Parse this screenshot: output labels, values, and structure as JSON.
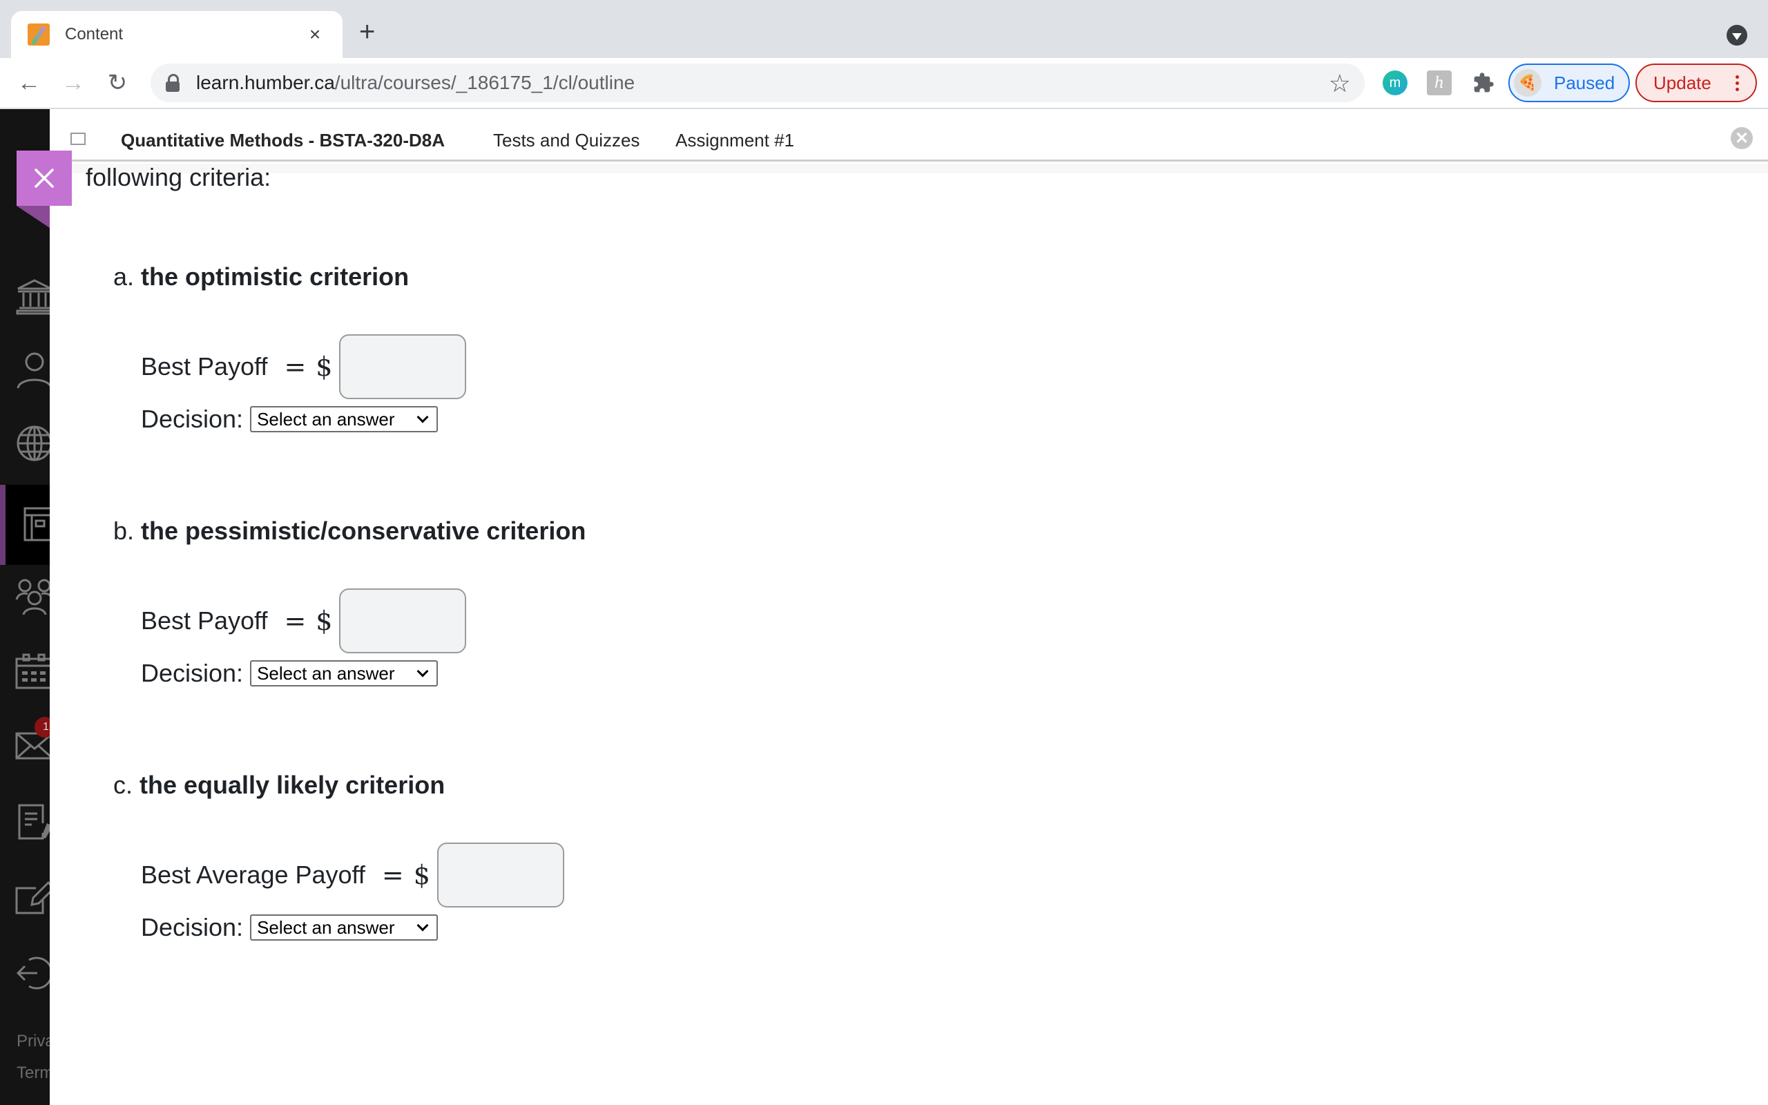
{
  "browser": {
    "tab": {
      "title": "Content",
      "favicon": "pencil-icon",
      "close_glyph": "×"
    },
    "new_tab_glyph": "+",
    "address": {
      "domain": "learn.humber.ca",
      "path": "/ultra/courses/_186175_1/cl/outline"
    },
    "nav": {
      "back_glyph": "←",
      "forward_glyph": "→",
      "reload_glyph": "↻"
    },
    "star_glyph": "☆",
    "extensions": [
      {
        "name": "m-extension",
        "label": "m"
      },
      {
        "name": "h-extension",
        "label": "h"
      },
      {
        "name": "extensions-puzzle",
        "label": "✱"
      }
    ],
    "profile": {
      "label": "Paused",
      "avatar_glyph": "🍕"
    },
    "update": {
      "label": "Update"
    },
    "colors": {
      "profile": "#1a73e8",
      "update": "#c5221f"
    }
  },
  "leftnav": {
    "items": [
      {
        "name": "institution",
        "icon": "institution-icon"
      },
      {
        "name": "profile",
        "icon": "person-icon"
      },
      {
        "name": "activity",
        "icon": "globe-icon"
      },
      {
        "name": "courses",
        "icon": "courses-icon",
        "active": true
      },
      {
        "name": "organizations",
        "icon": "groups-icon"
      },
      {
        "name": "calendar",
        "icon": "calendar-icon"
      },
      {
        "name": "messages",
        "icon": "mail-icon",
        "badge": "1"
      },
      {
        "name": "grades",
        "icon": "grades-icon"
      },
      {
        "name": "tools",
        "icon": "edit-icon"
      },
      {
        "name": "sign-out",
        "icon": "sign-out-icon"
      }
    ],
    "footer": {
      "privacy": "Privacy",
      "terms": "Terms"
    }
  },
  "course_bar": {
    "course": "Quantitative Methods - BSTA-320-D8A",
    "crumbs": [
      "Tests and Quizzes",
      "Assignment #1"
    ]
  },
  "question": {
    "intro": "following criteria:",
    "parts": [
      {
        "letter": "a.",
        "title": "the optimistic criterion",
        "payoff_label": "Best Payoff",
        "equals": "=",
        "currency": "$",
        "payoff_value": "",
        "decision_label": "Decision:",
        "decision_selected": "Select an answer"
      },
      {
        "letter": "b.",
        "title": "the pessimistic/conservative criterion",
        "payoff_label": "Best Payoff",
        "equals": "=",
        "currency": "$",
        "payoff_value": "",
        "decision_label": "Decision:",
        "decision_selected": "Select an answer"
      },
      {
        "letter": "c.",
        "title": "the equally likely criterion",
        "payoff_label": "Best Average Payoff",
        "equals": "=",
        "currency": "$",
        "payoff_value": "",
        "decision_label": "Decision:",
        "decision_selected": "Select an answer"
      }
    ]
  },
  "accent": {
    "close_panel": "#c573d2",
    "active_nav": "#6b3b78",
    "badge": "#8a1212"
  }
}
